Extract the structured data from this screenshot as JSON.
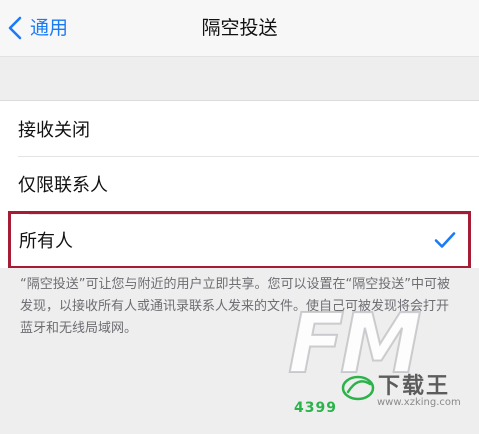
{
  "nav": {
    "back_label": "通用",
    "title": "隔空投送"
  },
  "options": [
    {
      "label": "接收关闭",
      "selected": false
    },
    {
      "label": "仅限联系人",
      "selected": false
    },
    {
      "label": "所有人",
      "selected": true
    }
  ],
  "footnote": "“隔空投送”可让您与附近的用户立即共享。您可以设置在“隔空投送”中可被发现，以接收所有人或通讯录联系人发来的文件。使自己可被发现将会打开蓝牙和无线局域网。",
  "watermark": {
    "logo_text": "FM",
    "brand": "下载王",
    "url": "www.xzking.com",
    "number": "4399"
  },
  "colors": {
    "accent": "#1a7cf5",
    "selection_border": "#a61b36",
    "group_background": "#eeeeef",
    "secondary_text": "#6d6d72"
  },
  "icons": {
    "back": "chevron-left-icon",
    "selected": "checkmark-icon"
  }
}
